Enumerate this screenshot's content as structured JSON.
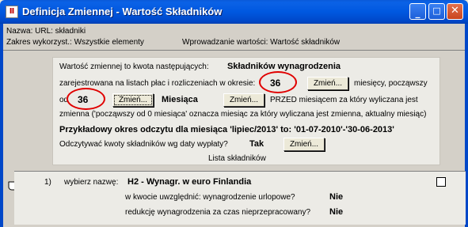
{
  "window": {
    "title": "Definicja Zmiennej - Wartość Składników",
    "icon_glyph": "Ⅱ",
    "buttons": {
      "minimize": "_",
      "maximize": "□",
      "close": "✕"
    }
  },
  "info": {
    "nazwa": "Nazwa:  URL: składniki",
    "zakres": "Zakres wykorzyst.: Wszystkie elementy",
    "wprowadzanie": "Wprowadzanie wartości: Wartość składników"
  },
  "card1": {
    "line1_text": "Wartość zmiennej to kwota następujących:",
    "line1_bold": "Składników wynagrodzenia",
    "line2_text": "zarejestrowana na listach płac i rozliczeniach w okresie:",
    "months_value": "36",
    "line2_suffix": "miesięcy, począwszy",
    "line3_prefix": "od",
    "from_value": "36",
    "line3_bold": "Miesiąca",
    "line3_suffix": "PRZED miesiącem za który wyliczana jest",
    "line4": "zmienna ('począwszy od 0 miesiąca' oznacza miesiąc za który wyliczana jest zmienna, aktualny miesiąc)",
    "line5": "Przykładowy okres odczytu dla miesiąca 'lipiec/2013' to: '01-07-2010'-'30-06-2013'",
    "line6_text": "Odczytywać kwoty składników wg daty wypłaty?",
    "line6_value": "Tak",
    "list_label": "Lista składników",
    "change_label": "Zmień..."
  },
  "card2": {
    "item_number": "1)",
    "choose_label": "wybierz nazwę:",
    "item_name": "H2 - Wynagr. w euro Finlandia",
    "q1": "w kwocie uwzględnić: wynagrodzenie urlopowe?",
    "a1": "Nie",
    "q2": "redukcję wynagrodzenia za czas nieprzepracowany?",
    "a2": "Nie",
    "checkbox_checked": false
  },
  "colors": {
    "titlebar": "#0058e0",
    "highlight_circle": "#e00000",
    "panel": "#d4d0c8",
    "card": "#ecebe6"
  }
}
